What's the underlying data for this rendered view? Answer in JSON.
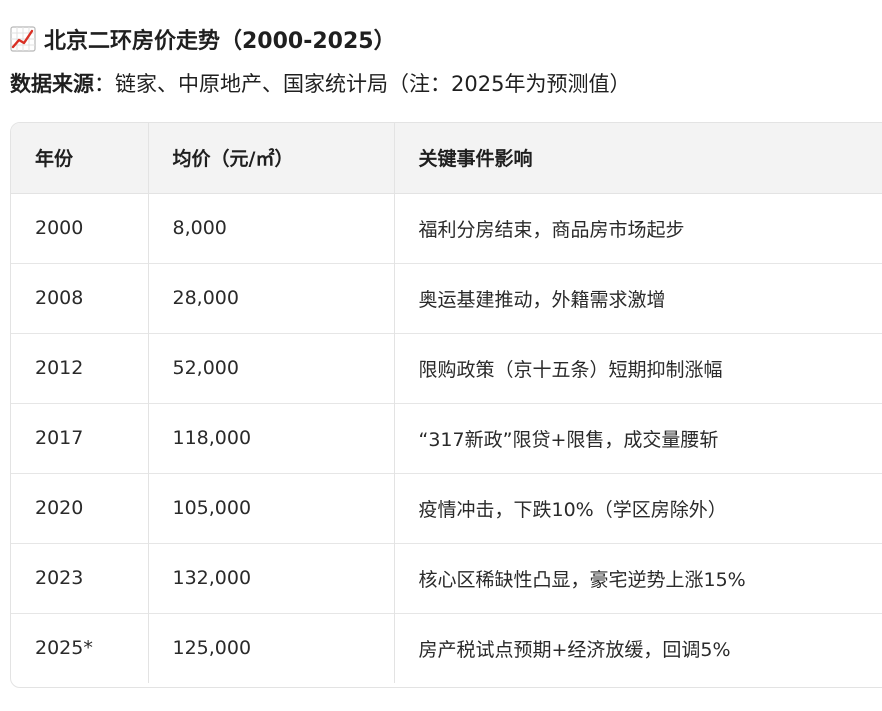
{
  "header": {
    "title_icon": "chart-increasing-icon",
    "title": "北京二环房价走势（2000-2025）",
    "source_label": "数据来源",
    "source_separator": "：",
    "source_text": "链家、中原地产、国家统计局（注：2025年为预测值）"
  },
  "colors": {
    "header_bg": "#f3f3f3",
    "border": "#e3e3e3",
    "trend_line": "#d93025"
  },
  "table": {
    "columns": [
      "年份",
      "均价（元/㎡）",
      "关键事件影响"
    ],
    "rows": [
      {
        "year": "2000",
        "price": "8,000",
        "event": "福利分房结束，商品房市场起步"
      },
      {
        "year": "2008",
        "price": "28,000",
        "event": "奥运基建推动，外籍需求激增"
      },
      {
        "year": "2012",
        "price": "52,000",
        "event": "限购政策（京十五条）短期抑制涨幅"
      },
      {
        "year": "2017",
        "price": "118,000",
        "event": "“317新政”限贷+限售，成交量腰斩"
      },
      {
        "year": "2020",
        "price": "105,000",
        "event": "疫情冲击，下跌10%（学区房除外）"
      },
      {
        "year": "2023",
        "price": "132,000",
        "event": "核心区稀缺性凸显，豪宅逆势上涨15%"
      },
      {
        "year": "2025*",
        "price": "125,000",
        "event": "房产税试点预期+经济放缓，回调5%"
      }
    ]
  }
}
